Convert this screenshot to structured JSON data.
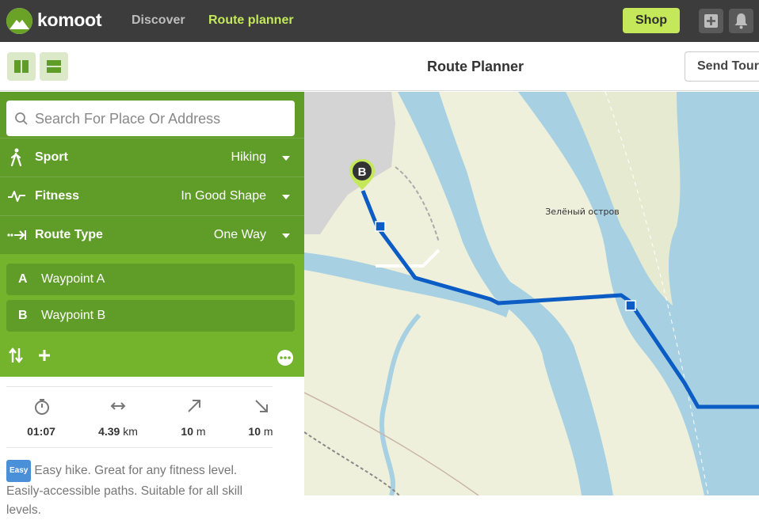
{
  "header": {
    "logo_text": "komoot",
    "nav": [
      {
        "label": "Discover"
      },
      {
        "label": "Route planner"
      }
    ],
    "shop_label": "Shop",
    "icons": [
      "plus-icon",
      "bell-icon"
    ]
  },
  "toolbar": {
    "layout_buttons": [
      "split-view-icon",
      "stacked-view-icon"
    ],
    "title": "Route Planner",
    "send_label": "Send Tour"
  },
  "planner": {
    "search_placeholder": "Search For Place Or Address",
    "options": [
      {
        "label": "Sport",
        "value": "Hiking",
        "icon": "hiker-icon"
      },
      {
        "label": "Fitness",
        "value": "In Good Shape",
        "icon": "pulse-icon"
      },
      {
        "label": "Route Type",
        "value": "One Way",
        "icon": "arrow-to-line-icon"
      }
    ],
    "waypoints": [
      {
        "letter": "A",
        "label": "Waypoint A"
      },
      {
        "letter": "B",
        "label": "Waypoint B"
      }
    ]
  },
  "stats": [
    {
      "icon": "stopwatch-icon",
      "value": "01:07",
      "unit": ""
    },
    {
      "icon": "distance-icon",
      "value": "4.39",
      "unit": "km"
    },
    {
      "icon": "uphill-icon",
      "value": "10",
      "unit": "m"
    },
    {
      "icon": "downhill-icon",
      "value": "10",
      "unit": "m"
    }
  ],
  "difficulty": {
    "badge": "Easy",
    "text": "Easy hike. Great for any fitness level. Easily-accessible paths. Suitable for all skill levels."
  },
  "map": {
    "place_label": "Зелёный остров",
    "marker_letter": "B",
    "colors": {
      "water": "#a7d1e2",
      "land": "#eef0dc",
      "route": "#0b5cc5",
      "urban": "#d4d4d4"
    }
  }
}
